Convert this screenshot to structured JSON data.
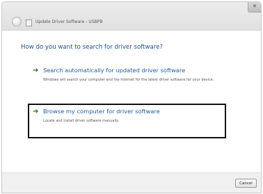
{
  "window": {
    "title": "Update Driver Software - USBPB",
    "close_label": "✕"
  },
  "main": {
    "question": "How do you want to search for driver software?",
    "options": [
      {
        "title": "Search automatically for updated driver software",
        "description": "Windows will search your computer and the Internet for the latest driver software for your device.",
        "arrow": "➔"
      },
      {
        "title": "Browse my computer for driver software",
        "description": "Locate and install driver software manually.",
        "arrow": "➔"
      }
    ]
  },
  "footer": {
    "cancel_label": "Cancel"
  },
  "colors": {
    "link_blue": "#1c5ea0",
    "arrow_green": "#2a6e2a",
    "highlight_border": "#111111"
  }
}
